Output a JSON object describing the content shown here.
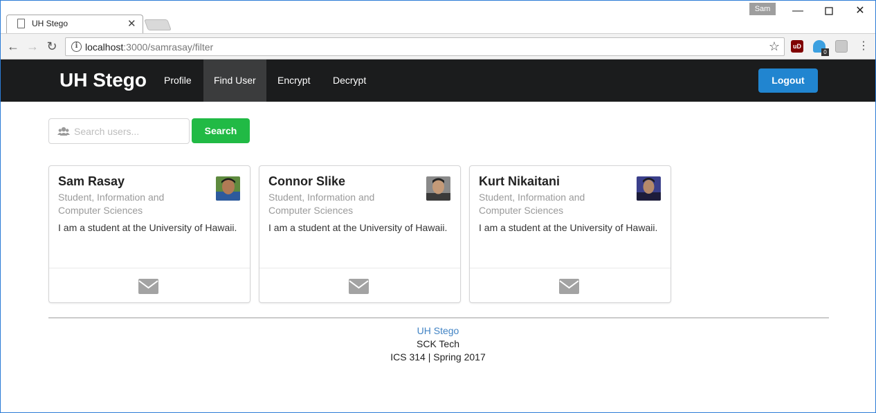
{
  "browser": {
    "tab_title": "UH Stego",
    "profile_name": "Sam",
    "url_host": "localhost",
    "url_path": ":3000/samrasay/filter",
    "extension_badge": "0",
    "ublock_label": "uD",
    "colors": {
      "ublock": "#800000",
      "ghostery": "#3ca0e0"
    }
  },
  "navbar": {
    "brand": "UH Stego",
    "items": [
      {
        "label": "Profile"
      },
      {
        "label": "Find User"
      },
      {
        "label": "Encrypt"
      },
      {
        "label": "Decrypt"
      }
    ],
    "active_item": "Find User",
    "logout_label": "Logout",
    "colors": {
      "background": "#1b1c1d",
      "logout": "#2185d0"
    }
  },
  "search": {
    "placeholder": "Search users...",
    "icon": "users-icon",
    "button_label": "Search",
    "button_color": "#21ba45"
  },
  "cards": [
    {
      "name": "Sam Rasay",
      "meta": "Student, Information and Computer Sciences",
      "description": "I am a student at the University of Hawaii.",
      "avatar": "avatar-sam",
      "icon": "mail-icon"
    },
    {
      "name": "Connor Slike",
      "meta": "Student, Information and Computer Sciences",
      "description": "I am a student at the University of Hawaii.",
      "avatar": "avatar-connor",
      "icon": "mail-icon"
    },
    {
      "name": "Kurt Nikaitani",
      "meta": "Student, Information and Computer Sciences",
      "description": "I am a student at the University of Hawaii.",
      "avatar": "avatar-kurt",
      "icon": "mail-icon"
    }
  ],
  "footer": {
    "link": "UH Stego",
    "company": "SCK Tech",
    "course": "ICS 314 | Spring 2017"
  }
}
